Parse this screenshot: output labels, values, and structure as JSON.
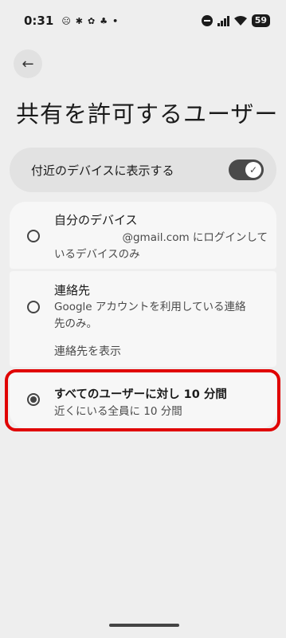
{
  "status_bar": {
    "time": "0:31",
    "left_icons": [
      "☹",
      "✱",
      "✿",
      "♣",
      "•"
    ],
    "battery": "59"
  },
  "header": {
    "back_icon": "←",
    "title": "共有を許可するユーザー"
  },
  "nearby_toggle": {
    "label": "付近のデバイスに表示する",
    "checked": true,
    "check_icon": "✓"
  },
  "options": {
    "own_devices": {
      "title": "自分のデバイス",
      "description_line1": "@gmail.com にログインして",
      "description_line2": "いるデバイスのみ",
      "selected": false
    },
    "contacts": {
      "title": "連絡先",
      "description_line1": "Google アカウントを利用している連絡",
      "description_line2": "先のみ。",
      "link": "連絡先を表示",
      "selected": false
    },
    "everyone": {
      "title": "すべてのユーザーに対し 10 分間",
      "description": "近くにいる全員に 10 分間",
      "selected": true
    }
  },
  "colors": {
    "highlight": "#e00000",
    "background": "#eeeeee"
  }
}
